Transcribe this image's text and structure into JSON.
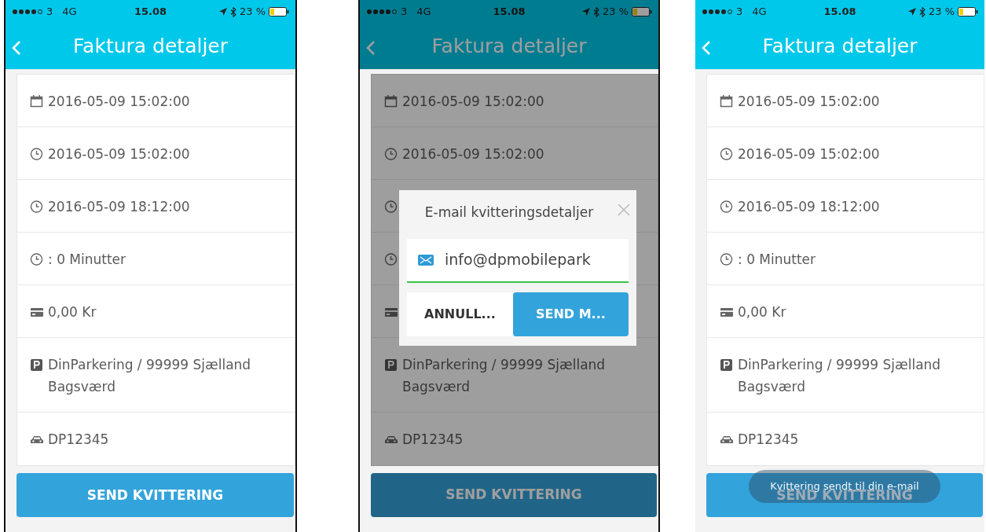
{
  "screens": [
    {
      "dimmed": false,
      "status_bar": {
        "carrier": "3",
        "network": "4G",
        "time": "15.08",
        "battery": "23 %"
      },
      "title": "Faktura detaljer",
      "items": [
        {
          "kind": "calendar",
          "text": "2016-05-09 15:02:00"
        },
        {
          "kind": "clock",
          "text": "2016-05-09 15:02:00"
        },
        {
          "kind": "clock",
          "text": "2016-05-09 18:12:00"
        },
        {
          "kind": "clock",
          "text": ": 0 Minutter"
        },
        {
          "kind": "card",
          "text": "0,00 Kr"
        },
        {
          "kind": "parking",
          "text": "DinParkering / 99999 Sjælland Bagsværd"
        },
        {
          "kind": "car",
          "text": "DP12345"
        }
      ],
      "button": "SEND KVITTERING"
    },
    {
      "dimmed": true,
      "status_bar": {
        "carrier": "3",
        "network": "4G",
        "time": "15.08",
        "battery": "23 %"
      },
      "title": "Faktura detaljer",
      "items": [
        {
          "kind": "calendar",
          "text": "2016-05-09 15:02:00"
        },
        {
          "kind": "clock",
          "text": "2016-05-09 15:02:00"
        },
        {
          "kind": "clock"
        },
        {
          "kind": "clock"
        },
        {
          "kind": "card"
        },
        {
          "kind": "parking",
          "text": "DinParkering / 99999 Sjælland Bagsværd"
        },
        {
          "kind": "car",
          "text": "DP12345"
        }
      ],
      "button": "SEND KVITTERING",
      "dialog": {
        "title": "E-mail kvitteringsdetaljer",
        "email": "info@dpmobilepark",
        "cancel": "ANNULL...",
        "confirm": "SEND M..."
      }
    },
    {
      "dimmed": false,
      "status_bar": {
        "carrier": "3",
        "network": "4G",
        "time": "15.08",
        "battery": "23 %"
      },
      "title": "Faktura detaljer",
      "items": [
        {
          "kind": "calendar",
          "text": "2016-05-09 15:02:00"
        },
        {
          "kind": "clock",
          "text": "2016-05-09 15:02:00"
        },
        {
          "kind": "clock",
          "text": "2016-05-09 18:12:00"
        },
        {
          "kind": "clock",
          "text": ": 0 Minutter"
        },
        {
          "kind": "card",
          "text": "0,00 Kr"
        },
        {
          "kind": "parking",
          "text": "DinParkering / 99999 Sjælland Bagsværd"
        },
        {
          "kind": "car",
          "text": "DP12345"
        }
      ],
      "button": "SEND KVITTERING",
      "toast": "Kvittering sendt til din e-mail"
    }
  ]
}
